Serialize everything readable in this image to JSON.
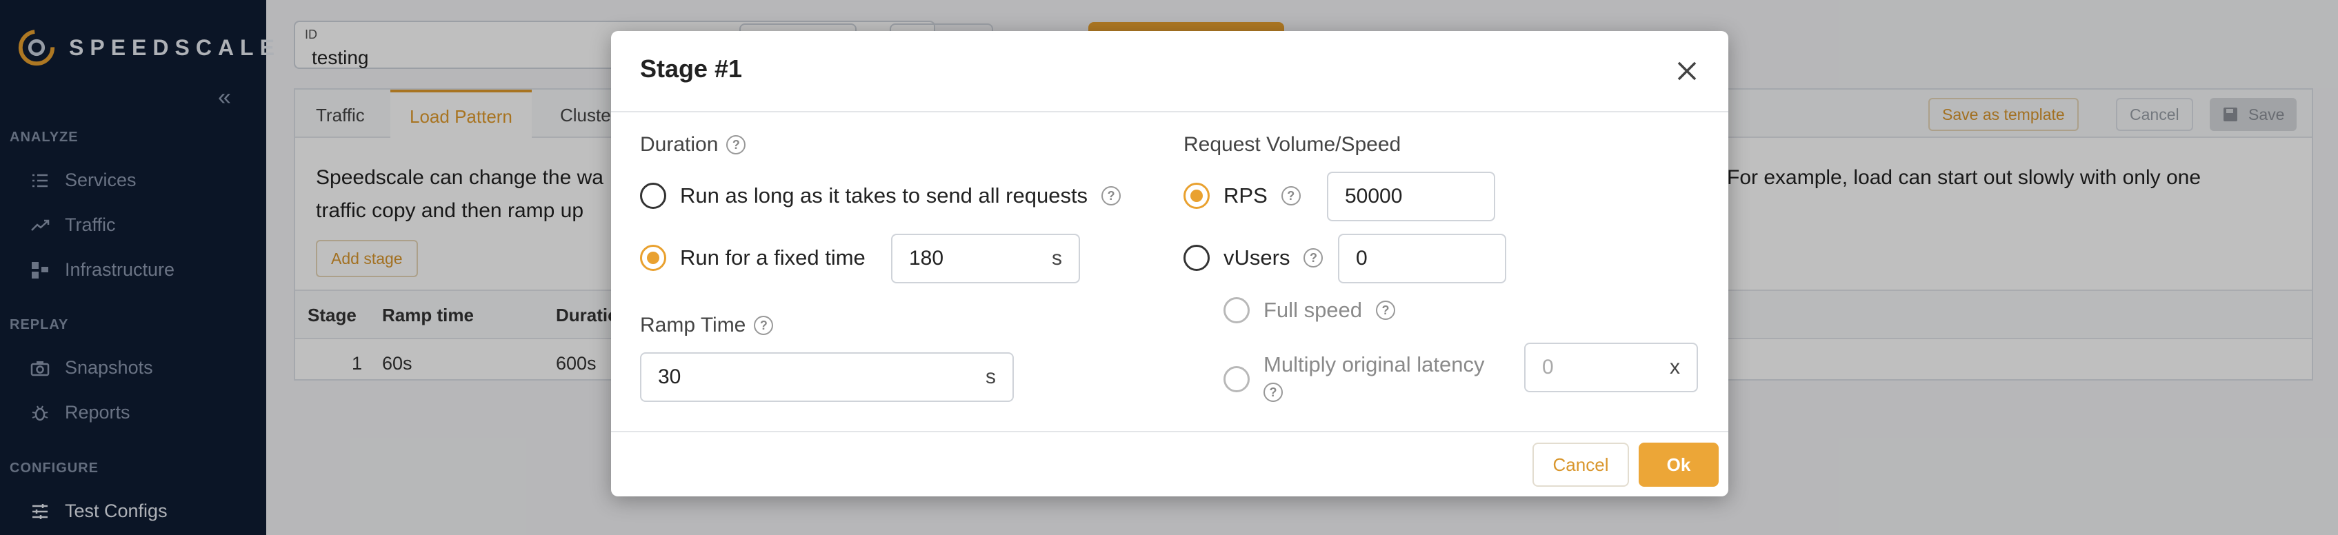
{
  "sidebar": {
    "brand": "SPEEDSCALE",
    "sections": {
      "analyze": "ANALYZE",
      "replay": "REPLAY",
      "configure": "CONFIGURE"
    },
    "items": {
      "services": "Services",
      "traffic": "Traffic",
      "infrastructure": "Infrastructure",
      "snapshots": "Snapshots",
      "reports": "Reports",
      "test_configs": "Test Configs"
    }
  },
  "page": {
    "id_label": "ID",
    "id_value": "testing",
    "tabs": [
      "Traffic",
      "Load Pattern",
      "Cluster"
    ],
    "save_as_template": "Save as template",
    "cancel": "Cancel",
    "save": "Save",
    "description_left_1": "Speedscale can change the wa",
    "description_left_2": "traffic copy and then ramp up",
    "description_right": "For example, load can start out slowly with only one",
    "add_stage": "Add stage",
    "table": {
      "headers": [
        "Stage",
        "Ramp time",
        "Duratio"
      ],
      "rows": [
        [
          "1",
          "60s",
          "600s"
        ]
      ]
    }
  },
  "modal": {
    "title": "Stage #1",
    "duration": {
      "label": "Duration",
      "option_all": "Run as long as it takes to send all requests",
      "option_fixed": "Run for a fixed time",
      "fixed_value": "180",
      "fixed_unit": "s"
    },
    "ramp": {
      "label": "Ramp Time",
      "value": "30",
      "unit": "s"
    },
    "volume": {
      "label": "Request Volume/Speed",
      "rps_label": "RPS",
      "rps_value": "50000",
      "vusers_label": "vUsers",
      "vusers_value": "0",
      "full_speed": "Full speed",
      "multiply_line1": "Multiply original latency",
      "multiply_value": "0",
      "multiply_unit": "x"
    },
    "cancel_label": "Cancel",
    "ok_label": "Ok"
  },
  "colors": {
    "accent": "#eca637",
    "sidebar_bg": "#0f1c33"
  }
}
